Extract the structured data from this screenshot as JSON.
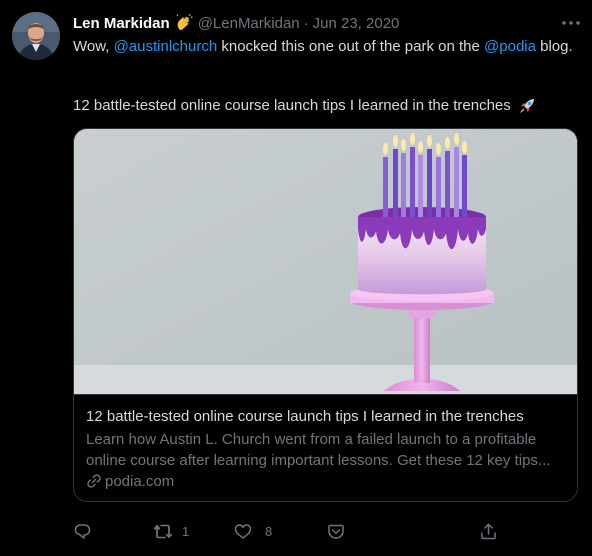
{
  "tweet": {
    "author": {
      "display_name": "Len Markidan",
      "name_emoji": "waving-hand-emoji",
      "handle": "@LenMarkidan",
      "separator": "·",
      "date": "Jun 23, 2020"
    },
    "text": {
      "part1": "Wow, ",
      "mention1": "@austinlchurch",
      "part2": " knocked this one out of the park on the ",
      "mention2": "@podia",
      "part3": " blog.",
      "line2": "12 battle-tested online course launch tips I learned in the trenches",
      "line2_emoji": "rocket-emoji"
    },
    "card": {
      "image": "birthday-cake-with-candles",
      "title": "12 battle-tested online course launch tips I learned in the trenches",
      "description": "Learn how Austin L. Church went from a failed launch to a profitable online course after learning important lessons. Get these 12 key tips...",
      "domain": "podia.com"
    },
    "actions": {
      "reply_count": "",
      "retweet_count": "1",
      "like_count": "8"
    }
  },
  "colors": {
    "background": "#000000",
    "text": "#d9d9d9",
    "muted": "#6e767d",
    "link": "#1d9bf0",
    "border": "#2f3336"
  },
  "icons": [
    "more-icon",
    "reply-icon",
    "retweet-icon",
    "like-icon",
    "share-via-icon",
    "share-icon",
    "link-icon"
  ]
}
